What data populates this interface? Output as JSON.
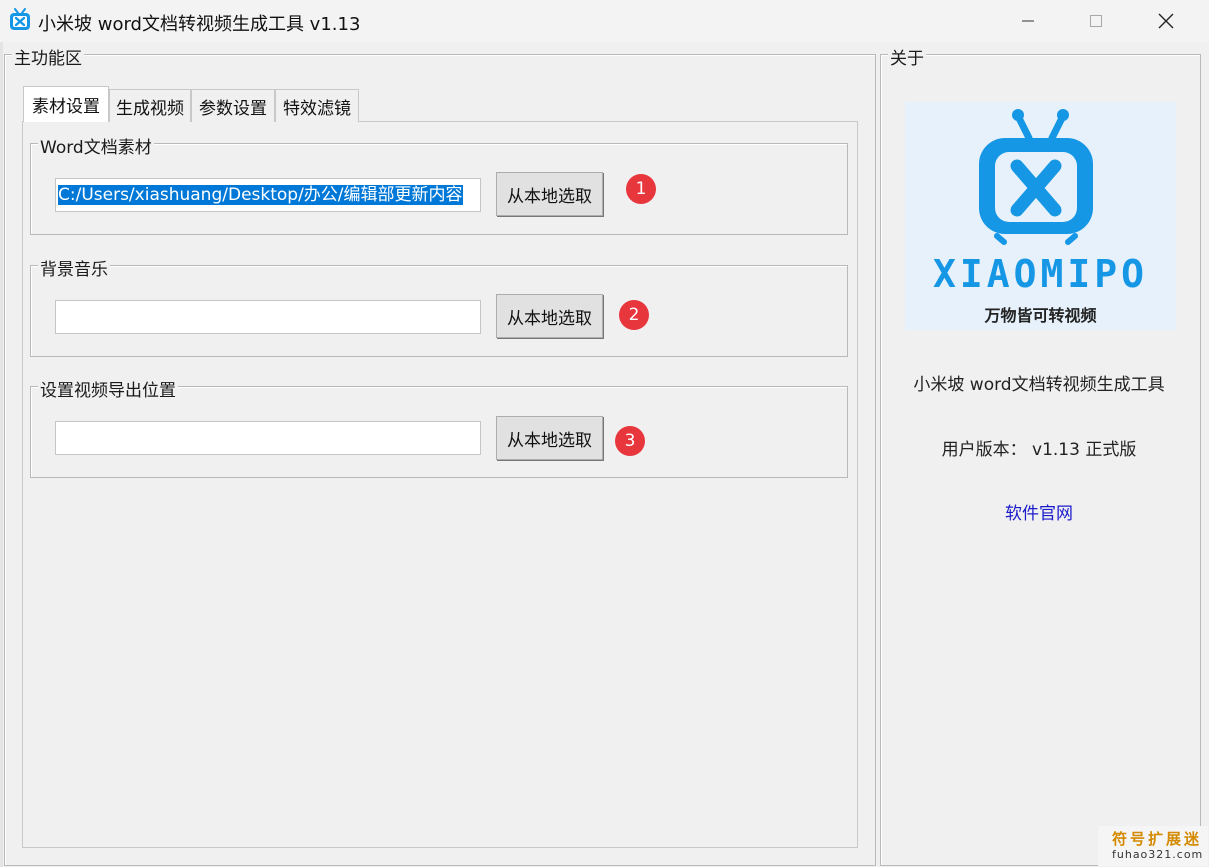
{
  "window": {
    "title": "小米坡 word文档转视频生成工具 v1.13",
    "icon": "app-logo-icon"
  },
  "main": {
    "group_title": "主功能区",
    "tabs": [
      {
        "label": "素材设置",
        "active": true
      },
      {
        "label": "生成视频",
        "active": false
      },
      {
        "label": "参数设置",
        "active": false
      },
      {
        "label": "特效滤镜",
        "active": false
      }
    ],
    "sections": [
      {
        "title": "Word文档素材",
        "value": "C:/Users/xiashuang/Desktop/办公/编辑部更新内容",
        "button": "从本地选取",
        "step": "1"
      },
      {
        "title": "背景音乐",
        "value": "",
        "button": "从本地选取",
        "step": "2"
      },
      {
        "title": "设置视频导出位置",
        "value": "",
        "button": "从本地选取",
        "step": "3"
      }
    ]
  },
  "about": {
    "group_title": "关于",
    "logo_wordmark": "XIAOMIPO",
    "logo_slogan": "万物皆可转视频",
    "product_name": "小米坡 word文档转视频生成工具",
    "version_text": "用户版本： v1.13 正式版",
    "website_link": "软件官网"
  },
  "watermark": {
    "top": "符号扩展迷",
    "bottom": "fuhao321.com"
  },
  "colors": {
    "accent": "#1597e5",
    "badge": "#e8363d",
    "selection": "#0078d7",
    "link": "#1a1acd"
  }
}
